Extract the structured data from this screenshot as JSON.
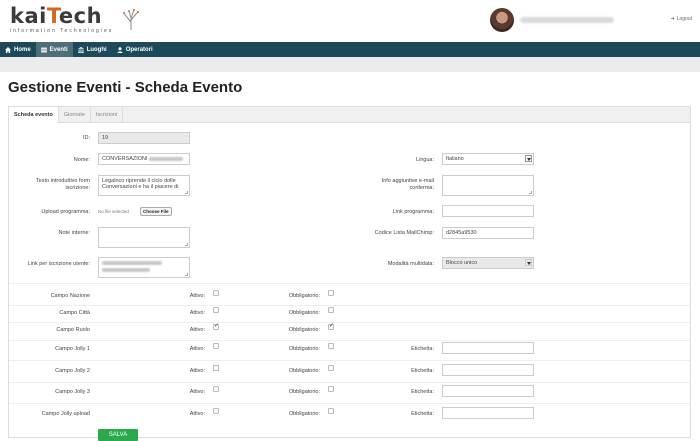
{
  "brand": {
    "logo_main": "kaiTech",
    "logo_sub": "information Technologies"
  },
  "user": {
    "logout_label": "Logout"
  },
  "nav": {
    "items": [
      {
        "label": "Home",
        "icon": "home-icon"
      },
      {
        "label": "Eventi",
        "icon": "list-icon",
        "active": true
      },
      {
        "label": "Luoghi",
        "icon": "building-icon"
      },
      {
        "label": "Operatori",
        "icon": "user-icon"
      }
    ]
  },
  "page": {
    "title": "Gestione Eventi - Scheda Evento"
  },
  "tabs": [
    "Scheda evento",
    "Giornate",
    "Iscrizioni"
  ],
  "form": {
    "id_label": "ID:",
    "id_value": "19",
    "nome_label": "Nome:",
    "nome_value": "CONVERSAZIONI",
    "lingua_label": "Lingua:",
    "lingua_value": "Italiano",
    "testo_label": "Testo introduttivo form iscrizione:",
    "testo_value": "Legalnco riprende il ciclo dolle Conversazioni e ha il piacere di",
    "info_label": "Info aggiuntive e-mail conferma:",
    "upload_label": "Upload programma:",
    "file_button": "Choose File",
    "file_status": "No file selected",
    "link_label": "Link programma:",
    "note_label": "Note interne:",
    "codice_label": "Codice Lista MailChimp:",
    "codice_value": "d2845a9530",
    "link_iscr_label": "Link per iscrizione utente:",
    "modalita_label": "Modalità multidata:",
    "modalita_value": "Blocco unico",
    "attivo_label": "Attivo:",
    "obbligatorio_label": "Obbligatorio:",
    "etichetta_label": "Etichetta:",
    "campi": [
      {
        "label": "Campo Nazione",
        "attivo": false,
        "obbligatorio": false,
        "etichetta": false
      },
      {
        "label": "Campo Città",
        "attivo": false,
        "obbligatorio": false,
        "etichetta": false
      },
      {
        "label": "Campo Ruolo",
        "attivo": true,
        "obbligatorio": true,
        "etichetta": false
      },
      {
        "label": "Campo Jolly 1",
        "attivo": false,
        "obbligatorio": false,
        "etichetta": true
      },
      {
        "label": "Campo Jolly 2",
        "attivo": false,
        "obbligatorio": false,
        "etichetta": true
      },
      {
        "label": "Campo Jolly 3",
        "attivo": false,
        "obbligatorio": false,
        "etichetta": true
      },
      {
        "label": "Campo Jolly upload",
        "attivo": false,
        "obbligatorio": false,
        "etichetta": true
      }
    ],
    "save_label": "SALVA"
  }
}
